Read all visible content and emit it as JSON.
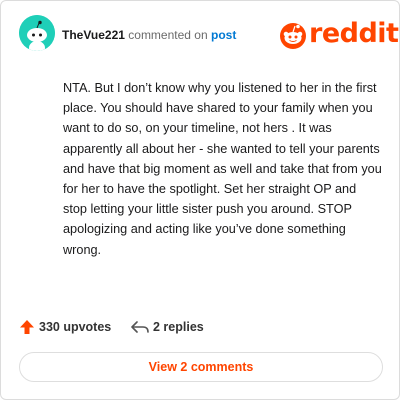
{
  "comment": {
    "username": "TheVue221",
    "action_text": "commented on",
    "target_link": "post",
    "body": "NTA. But I don’t know why you listened to her in the first place. You should have shared to your family when you want to do so, on your timeline, not hers . It was apparently all about her - she wanted to tell your parents and have that big moment as well and take that from you for her to have the spotlight. Set her straight OP and stop letting your little sister push you around. STOP apologizing and acting like you’ve done something wrong."
  },
  "brand": {
    "name": "reddit",
    "icon": "reddit-alien-icon",
    "color": "#ff4500"
  },
  "avatar": {
    "icon": "snoo-avatar-icon",
    "color": "#1fcfb8"
  },
  "footer": {
    "upvotes_label": "330 upvotes",
    "replies_label": "2 replies",
    "view_button_label": "View 2 comments",
    "upvote_icon": "upvote-arrow-icon",
    "reply_icon": "reply-arrow-icon"
  }
}
